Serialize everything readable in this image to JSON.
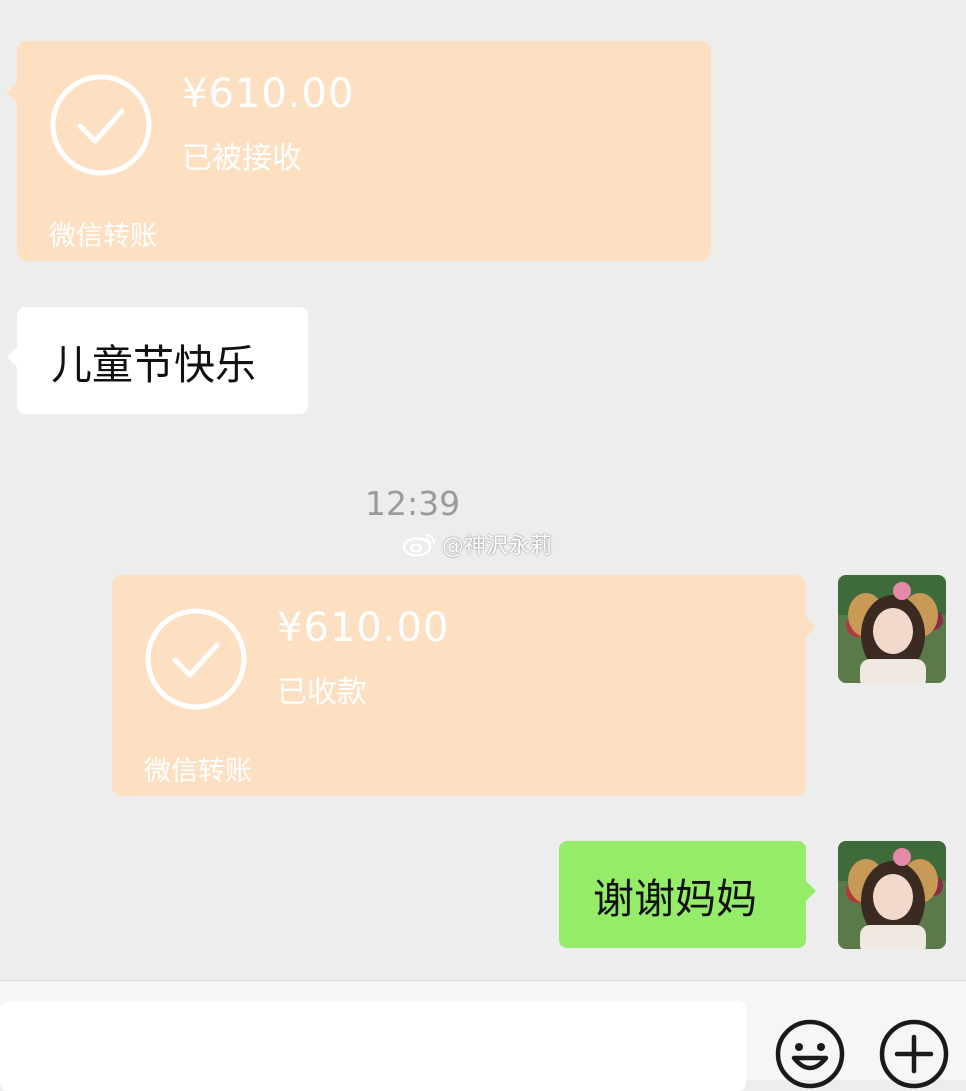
{
  "chat": {
    "messages": [
      {
        "type": "transfer",
        "side": "left",
        "amount": "¥610.00",
        "status": "已被接收",
        "footer": "微信转账"
      },
      {
        "type": "text",
        "side": "left",
        "text": "儿童节快乐"
      },
      {
        "type": "timestamp",
        "text": "12:39"
      },
      {
        "type": "transfer",
        "side": "right",
        "amount": "¥610.00",
        "status": "已收款",
        "footer": "微信转账"
      },
      {
        "type": "text",
        "side": "right",
        "text": "谢谢妈妈"
      }
    ],
    "watermark": "@神沢永莉"
  },
  "input_bar": {
    "icons": [
      "emoji-icon",
      "add-icon"
    ]
  },
  "colors": {
    "background": "#ededed",
    "transfer_card": "#fde0c2",
    "own_bubble": "#95ec69",
    "other_bubble": "#ffffff",
    "timestamp": "#9a9a9a"
  }
}
